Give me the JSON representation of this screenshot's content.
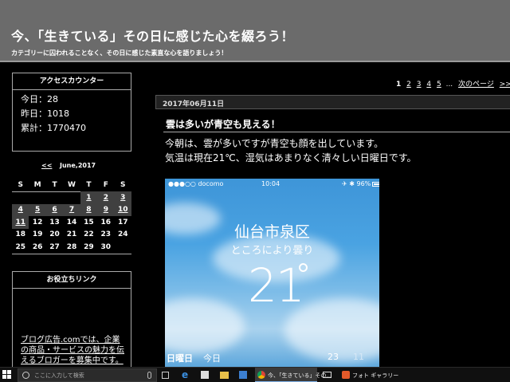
{
  "header": {
    "title": "今、「生きている」その日に感じた心を綴ろう！",
    "description": "カテゴリーに囚われることなく、その日に感じた素直な心を語りましょう！"
  },
  "counter": {
    "title": "アクセスカウンター",
    "rows": [
      {
        "label": "今日",
        "value": "28"
      },
      {
        "label": "昨日",
        "value": "1018"
      },
      {
        "label": "累計",
        "value": "1770470"
      }
    ]
  },
  "calendar": {
    "prev_label": "<<",
    "month_label": "June,2017",
    "weekdays": [
      "S",
      "M",
      "T",
      "W",
      "T",
      "F",
      "S"
    ],
    "weeks": [
      [
        "",
        "",
        "",
        "",
        "1",
        "2",
        "3"
      ],
      [
        "4",
        "5",
        "6",
        "7",
        "8",
        "9",
        "10"
      ],
      [
        "11",
        "12",
        "13",
        "14",
        "15",
        "16",
        "17"
      ],
      [
        "18",
        "19",
        "20",
        "21",
        "22",
        "23",
        "24"
      ],
      [
        "25",
        "26",
        "27",
        "28",
        "29",
        "30",
        ""
      ]
    ]
  },
  "links_box": {
    "title": "お役立ちリンク",
    "text": "ブログ広告.comでは、企業の商品・サービスの魅力を伝えるブロガーを募集中です。"
  },
  "pager": {
    "current": "1",
    "pages": [
      "2",
      "3",
      "4",
      "5"
    ],
    "ellipsis": "...",
    "next_label": "次のページ",
    "last_label": ">>|"
  },
  "post": {
    "date": "2017年06月11日",
    "title": "雲は多いが青空も見える！",
    "body_lines": [
      "今朝は、雲が多いですが青空も顔を出しています。",
      "気温は現在21℃、湿気はあまりなく清々しい日曜日です。"
    ]
  },
  "phone": {
    "carrier": "●●●○○ docomo",
    "time": "10:04",
    "battery": "✈ ✱ 96%",
    "city": "仙台市泉区",
    "condition": "ところにより曇り",
    "temperature": "21",
    "day": "日曜日",
    "today_label": "今日",
    "high": "23",
    "low": "11"
  },
  "taskbar": {
    "search_placeholder": "ここに入力して検索",
    "tasks": [
      {
        "label": "今、「生きている」その...",
        "active": true
      },
      {
        "label": "フォト ギャラリー",
        "active": false
      }
    ]
  }
}
